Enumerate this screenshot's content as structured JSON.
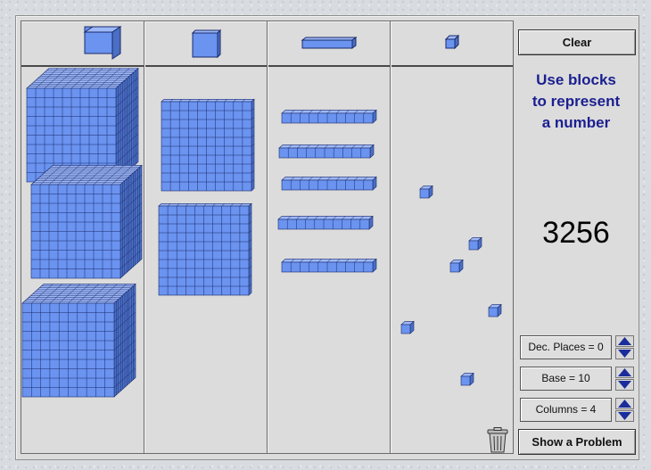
{
  "header": {
    "columns": [
      {
        "icon": "thousands-cube-icon"
      },
      {
        "icon": "hundreds-flat-icon"
      },
      {
        "icon": "tens-rod-icon"
      },
      {
        "icon": "ones-unit-icon"
      }
    ]
  },
  "controls": {
    "clear_label": "Clear",
    "instruction_line1": "Use blocks",
    "instruction_line2": "to represent",
    "instruction_line3": "a number",
    "target_number": "3256",
    "settings": [
      {
        "label": "Dec. Places = 0"
      },
      {
        "label": "Base = 10"
      },
      {
        "label": "Columns = 4"
      }
    ],
    "show_problem_label": "Show a Problem",
    "trash_icon": "trash-can-icon"
  },
  "workspace": {
    "thousands_count": 3,
    "hundreds_count": 2,
    "tens_count": 5,
    "ones_count": 6
  },
  "colors": {
    "block_face": "#6b93f0",
    "block_top": "#9fb9f8",
    "block_side": "#4a6fc4",
    "grid_line": "#1a2a6a",
    "instruction_text": "#1b1f8f"
  }
}
